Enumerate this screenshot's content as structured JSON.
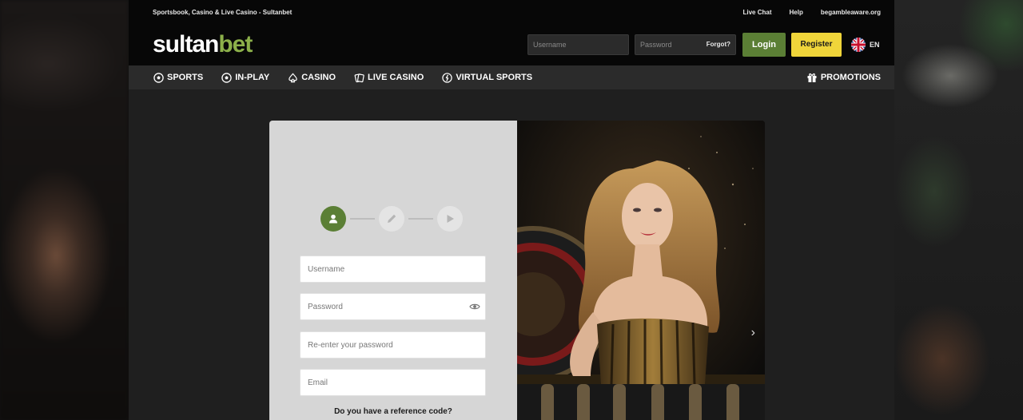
{
  "header": {
    "tagline": "Sportsbook, Casino & Live Casino - Sultanbet",
    "links": [
      "Live Chat",
      "Help",
      "begambleaware.org"
    ],
    "logo": {
      "part1": "sultan",
      "part2": "bet"
    }
  },
  "login": {
    "username_placeholder": "Username",
    "password_placeholder": "Password",
    "forgot_label": "Forgot?",
    "login_label": "Login",
    "register_label": "Register",
    "language": "EN"
  },
  "nav": {
    "items": [
      {
        "label": "SPORTS",
        "icon": "soccer-ball-icon"
      },
      {
        "label": "IN-PLAY",
        "icon": "soccer-ball-icon"
      },
      {
        "label": "CASINO",
        "icon": "spade-icon"
      },
      {
        "label": "LIVE CASINO",
        "icon": "cards-icon"
      },
      {
        "label": "VIRTUAL SPORTS",
        "icon": "runner-icon"
      }
    ],
    "promotions_label": "PROMOTIONS"
  },
  "registration": {
    "username_placeholder": "Username",
    "password_placeholder": "Password",
    "repassword_placeholder": "Re-enter your password",
    "email_placeholder": "Email",
    "reference_question": "Do you have a reference code?"
  },
  "colors": {
    "accent_green": "#5b7f35",
    "register_yellow": "#f0d53a",
    "logo_green": "#8cb04a"
  }
}
